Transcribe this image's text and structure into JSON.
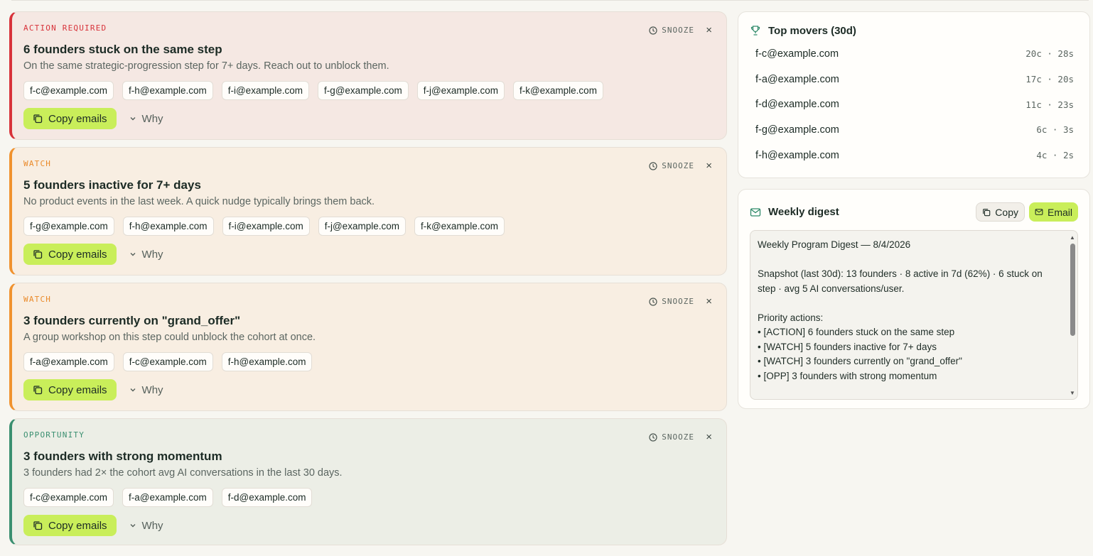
{
  "cards": [
    {
      "kind": "action",
      "tag": "ACTION REQUIRED",
      "title": "6 founders stuck on the same step",
      "desc": "On the same strategic-progression step for 7+ days. Reach out to unblock them.",
      "emails": [
        "f-c@example.com",
        "f-h@example.com",
        "f-i@example.com",
        "f-g@example.com",
        "f-j@example.com",
        "f-k@example.com"
      ],
      "snooze": "SNOOZE",
      "close": "×",
      "copy_label": "Copy emails",
      "why_label": "Why"
    },
    {
      "kind": "watch",
      "tag": "WATCH",
      "title": "5 founders inactive for 7+ days",
      "desc": "No product events in the last week. A quick nudge typically brings them back.",
      "emails": [
        "f-g@example.com",
        "f-h@example.com",
        "f-i@example.com",
        "f-j@example.com",
        "f-k@example.com"
      ],
      "snooze": "SNOOZE",
      "close": "×",
      "copy_label": "Copy emails",
      "why_label": "Why"
    },
    {
      "kind": "watch",
      "tag": "WATCH",
      "title": "3 founders currently on \"grand_offer\"",
      "desc": "A group workshop on this step could unblock the cohort at once.",
      "emails": [
        "f-a@example.com",
        "f-c@example.com",
        "f-h@example.com"
      ],
      "snooze": "SNOOZE",
      "close": "×",
      "copy_label": "Copy emails",
      "why_label": "Why"
    },
    {
      "kind": "opp",
      "tag": "OPPORTUNITY",
      "title": "3 founders with strong momentum",
      "desc": "3 founders had 2× the cohort avg AI conversations in the last 30 days.",
      "emails": [
        "f-c@example.com",
        "f-a@example.com",
        "f-d@example.com"
      ],
      "snooze": "SNOOZE",
      "close": "×",
      "copy_label": "Copy emails",
      "why_label": "Why"
    }
  ],
  "top_movers": {
    "title": "Top movers (30d)",
    "items": [
      {
        "email": "f-c@example.com",
        "stats": "20c · 28s"
      },
      {
        "email": "f-a@example.com",
        "stats": "17c · 20s"
      },
      {
        "email": "f-d@example.com",
        "stats": "11c · 23s"
      },
      {
        "email": "f-g@example.com",
        "stats": "6c · 3s"
      },
      {
        "email": "f-h@example.com",
        "stats": "4c · 2s"
      }
    ]
  },
  "digest": {
    "title": "Weekly digest",
    "copy_label": "Copy",
    "email_label": "Email",
    "text": "Weekly Program Digest — 8/4/2026\n\nSnapshot (last 30d): 13 founders · 8 active in 7d (62%) · 6 stuck on step · avg 5 AI conversations/user.\n\nPriority actions:\n• [ACTION] 6 founders stuck on the same step\n• [WATCH] 5 founders inactive for 7+ days\n• [WATCH] 3 founders currently on \"grand_offer\"\n• [OPP] 3 founders with strong momentum"
  },
  "colors": {
    "action": "#d8323a",
    "watch": "#f0922e",
    "opportunity": "#3a8f70",
    "accent_button": "#c9ee5a"
  }
}
